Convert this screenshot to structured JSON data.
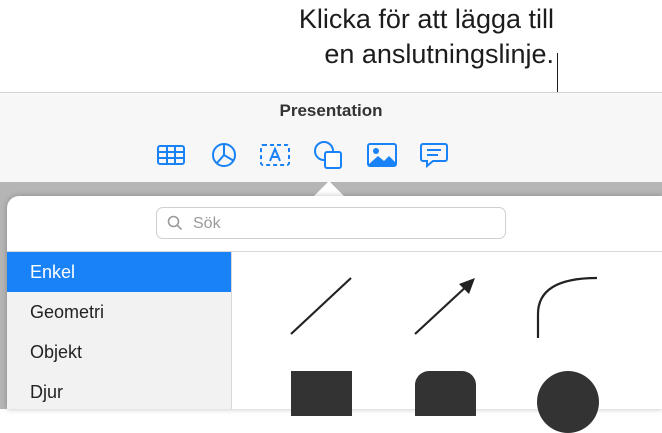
{
  "callout": {
    "line1": "Klicka för att lägga till",
    "line2": "en anslutningslinje."
  },
  "app": {
    "title": "Presentation",
    "toolbar": [
      {
        "name": "table-icon"
      },
      {
        "name": "chart-icon"
      },
      {
        "name": "text-box-icon"
      },
      {
        "name": "shape-icon"
      },
      {
        "name": "media-icon"
      },
      {
        "name": "comment-icon"
      }
    ],
    "accent": "#1a82f7"
  },
  "shapes_panel": {
    "search": {
      "placeholder": "Sök",
      "value": ""
    },
    "categories": [
      {
        "label": "Enkel",
        "selected": true
      },
      {
        "label": "Geometri",
        "selected": false
      },
      {
        "label": "Objekt",
        "selected": false
      },
      {
        "label": "Djur",
        "selected": false
      }
    ],
    "shapes": [
      {
        "name": "line-shape"
      },
      {
        "name": "arrow-line-shape"
      },
      {
        "name": "curved-connection-line-shape"
      },
      {
        "name": "square-shape"
      },
      {
        "name": "rounded-square-shape"
      },
      {
        "name": "circle-shape"
      }
    ]
  }
}
